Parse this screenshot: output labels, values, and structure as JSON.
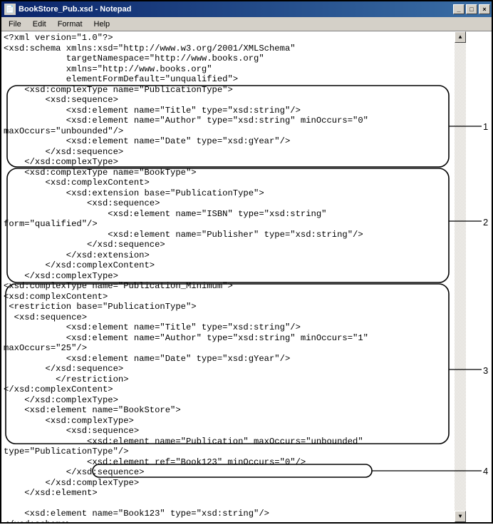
{
  "window": {
    "title": "BookStore_Pub.xsd - Notepad",
    "icon_glyph": "📄",
    "buttons": {
      "min": "_",
      "max": "□",
      "close": "×"
    }
  },
  "menubar": {
    "items": [
      "File",
      "Edit",
      "Format",
      "Help"
    ]
  },
  "content": "<?xml version=\"1.0\"?>\n<xsd:schema xmlns:xsd=\"http://www.w3.org/2001/XMLSchema\"\n            targetNamespace=\"http://www.books.org\"\n            xmlns=\"http://www.books.org\"\n            elementFormDefault=\"unqualified\">\n    <xsd:complexType name=\"PublicationType\">\n        <xsd:sequence>\n            <xsd:element name=\"Title\" type=\"xsd:string\"/>\n            <xsd:element name=\"Author\" type=\"xsd:string\" minOccurs=\"0\"\nmaxOccurs=\"unbounded\"/>\n            <xsd:element name=\"Date\" type=\"xsd:gYear\"/>\n        </xsd:sequence>\n    </xsd:complexType>\n    <xsd:complexType name=\"BookType\">\n        <xsd:complexContent>\n            <xsd:extension base=\"PublicationType\">\n                <xsd:sequence>\n                    <xsd:element name=\"ISBN\" type=\"xsd:string\"\nform=\"qualified\"/>\n                    <xsd:element name=\"Publisher\" type=\"xsd:string\"/>\n                </xsd:sequence>\n            </xsd:extension>\n        </xsd:complexContent>\n    </xsd:complexType>\n<xsd:complexType name=\"Publication_Minimum\">\n<xsd:complexContent>\n <restriction base=\"PublicationType\">\n  <xsd:sequence>\n            <xsd:element name=\"Title\" type=\"xsd:string\"/>\n            <xsd:element name=\"Author\" type=\"xsd:string\" minOccurs=\"1\"\nmaxOccurs=\"25\"/>\n            <xsd:element name=\"Date\" type=\"xsd:gYear\"/>\n        </xsd:sequence>\n          </restriction>\n</xsd:complexContent>\n    </xsd:complexType>\n    <xsd:element name=\"BookStore\">\n        <xsd:complexType>\n            <xsd:sequence>\n                <xsd:element name=\"Publication\" maxOccurs=\"unbounded\"\ntype=\"PublicationType\"/>\n                <xsd:element ref=\"Book123\" minOccurs=\"0\"/>\n            </xsd:sequence>\n        </xsd:complexType>\n    </xsd:element>\n\n    <xsd:element name=\"Book123\" type=\"xsd:string\"/>\n</xsd:schema>",
  "annotations": {
    "labels": {
      "a1": "1",
      "a2": "2",
      "a3": "3",
      "a4": "4"
    }
  }
}
